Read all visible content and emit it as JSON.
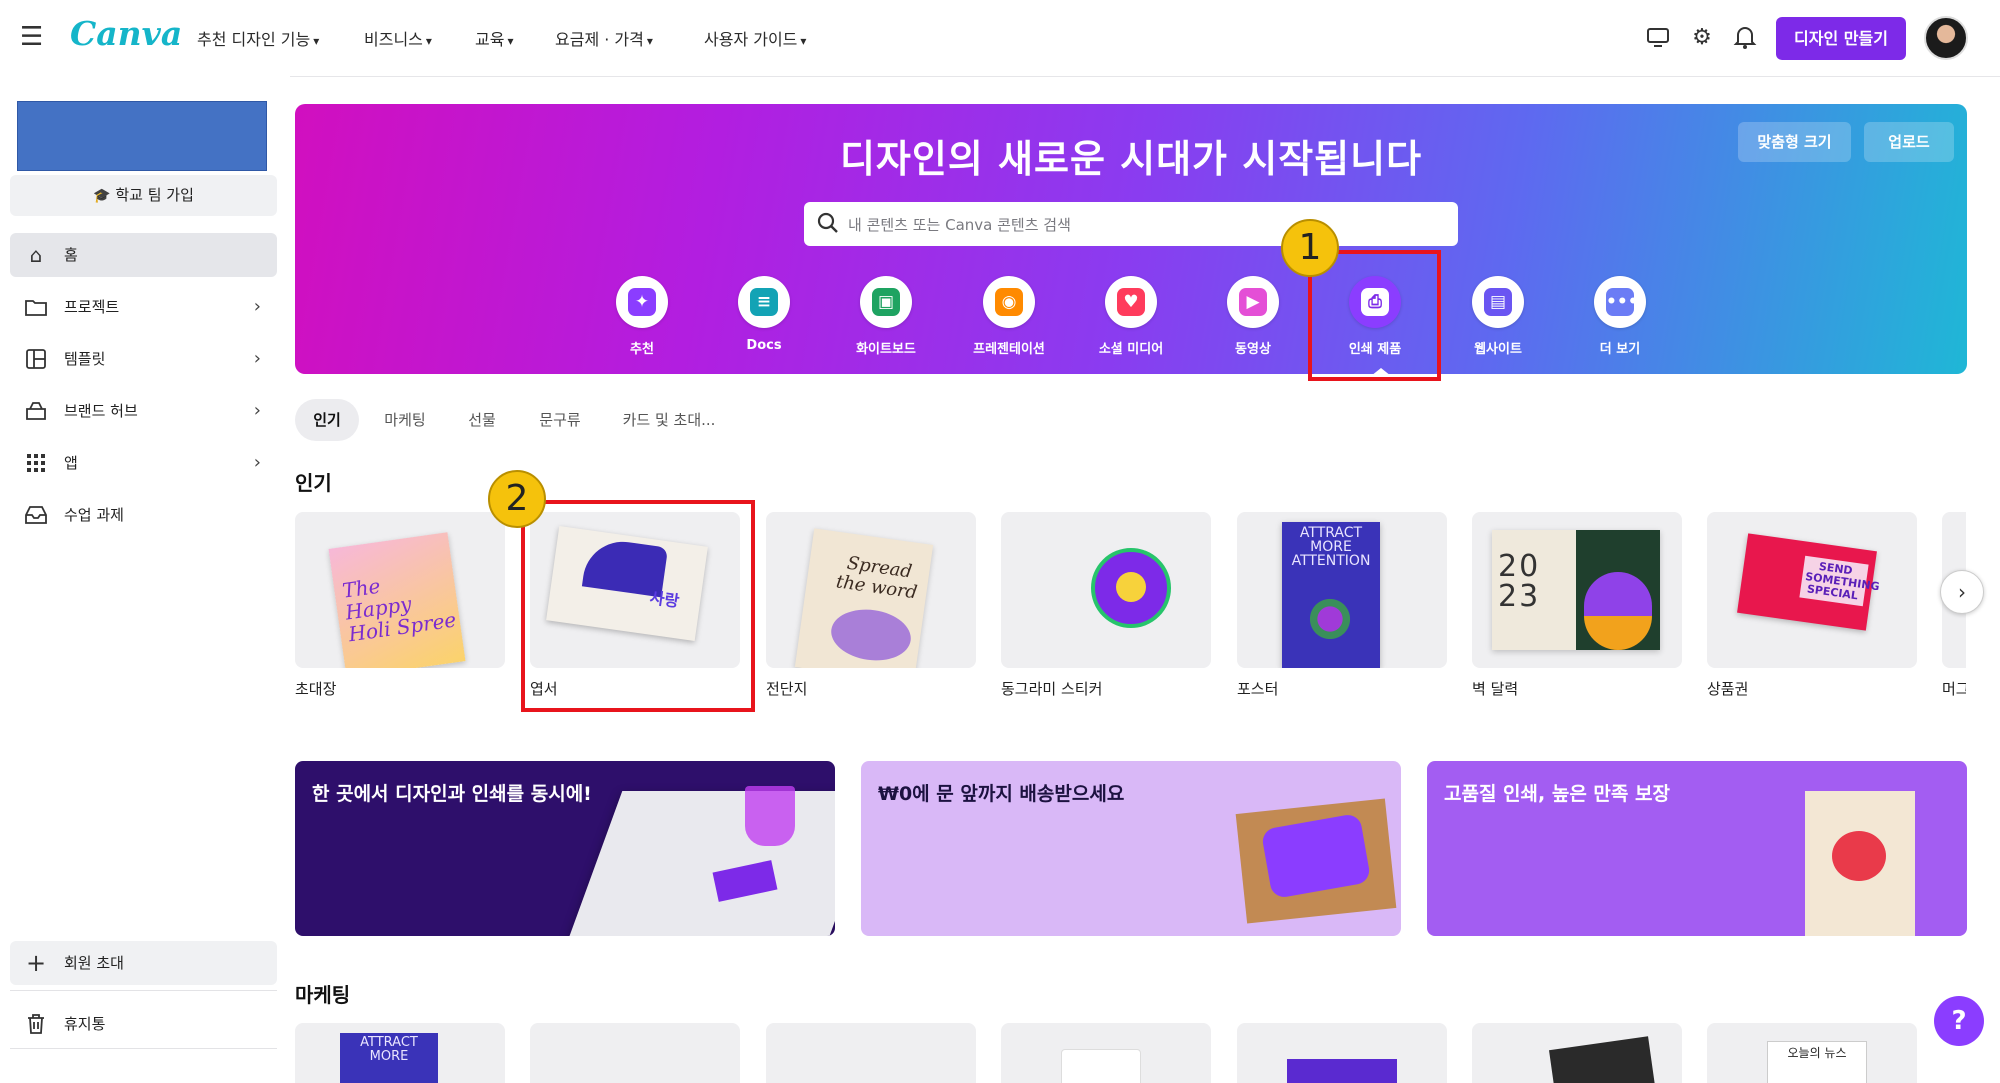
{
  "topbar": {
    "logo": "Canva",
    "nav": [
      "추천 디자인 기능",
      "비즈니스",
      "교육",
      "요금제 · 가격",
      "사용자 가이드"
    ],
    "create_label": "디자인 만들기"
  },
  "sidebar": {
    "team_button": "학교 팀 가입",
    "items": [
      {
        "label": "홈",
        "icon": "home-icon"
      },
      {
        "label": "프로젝트",
        "icon": "folder-icon"
      },
      {
        "label": "템플릿",
        "icon": "template-icon"
      },
      {
        "label": "브랜드 허브",
        "icon": "brand-icon"
      },
      {
        "label": "앱",
        "icon": "apps-grid-icon"
      },
      {
        "label": "수업 과제",
        "icon": "inbox-icon"
      }
    ],
    "invite_label": "회원 초대",
    "trash_label": "휴지통"
  },
  "hero": {
    "title": "디자인의 새로운 시대가 시작됩니다",
    "custom_size": "맞춤형 크기",
    "upload": "업로드",
    "search_placeholder": "내 콘텐츠 또는 Canva 콘텐츠 검색",
    "categories": [
      {
        "label": "추천",
        "color": "#8b3dff",
        "icon": "sparkle-icon"
      },
      {
        "label": "Docs",
        "color": "#13a3b5",
        "icon": "docs-icon"
      },
      {
        "label": "화이트보드",
        "color": "#1ea361",
        "icon": "whiteboard-icon"
      },
      {
        "label": "프레젠테이션",
        "color": "#ff8a00",
        "icon": "presentation-icon"
      },
      {
        "label": "소셜 미디어",
        "color": "#ff3b5c",
        "icon": "heart-icon"
      },
      {
        "label": "동영상",
        "color": "#e44fd6",
        "icon": "video-icon"
      },
      {
        "label": "인쇄 제품",
        "color": "#7d2ae8",
        "icon": "printer-icon"
      },
      {
        "label": "웹사이트",
        "color": "#6a55f2",
        "icon": "website-icon"
      },
      {
        "label": "더 보기",
        "color": "#6b7cf5",
        "icon": "more-icon"
      }
    ]
  },
  "annotations": {
    "badge1": "1",
    "badge2": "2"
  },
  "chips": [
    "인기",
    "마케팅",
    "선물",
    "문구류",
    "카드 및 초대..."
  ],
  "popular": {
    "title": "인기",
    "cards": [
      {
        "label": "초대장",
        "thumb": "The Happy Holi Spree"
      },
      {
        "label": "엽서",
        "thumb": "사랑"
      },
      {
        "label": "전단지",
        "thumb": "Spread the word"
      },
      {
        "label": "동그라미 스티커",
        "thumb": ""
      },
      {
        "label": "포스터",
        "thumb": "ATTRACT MORE ATTENTION"
      },
      {
        "label": "벽 달력",
        "thumb": "20 23"
      },
      {
        "label": "상품권",
        "thumb": "SEND SOMETHING SPECIAL"
      },
      {
        "label": "머그",
        "thumb": ""
      }
    ]
  },
  "banners": [
    {
      "title": "한 곳에서 디자인과 인쇄를 동시에!",
      "color": "#2e0f6b"
    },
    {
      "title": "₩0에 문 앞까지 배송받으세요",
      "color": "#d9b8f7"
    },
    {
      "title": "고품질 인쇄, 높은 만족 보장",
      "color": "#a35df2"
    }
  ],
  "marketing": {
    "title": "마케팅",
    "first_thumb": "ATTRACT MORE",
    "last_thumb": "오늘의 뉴스"
  },
  "help_label": "?"
}
